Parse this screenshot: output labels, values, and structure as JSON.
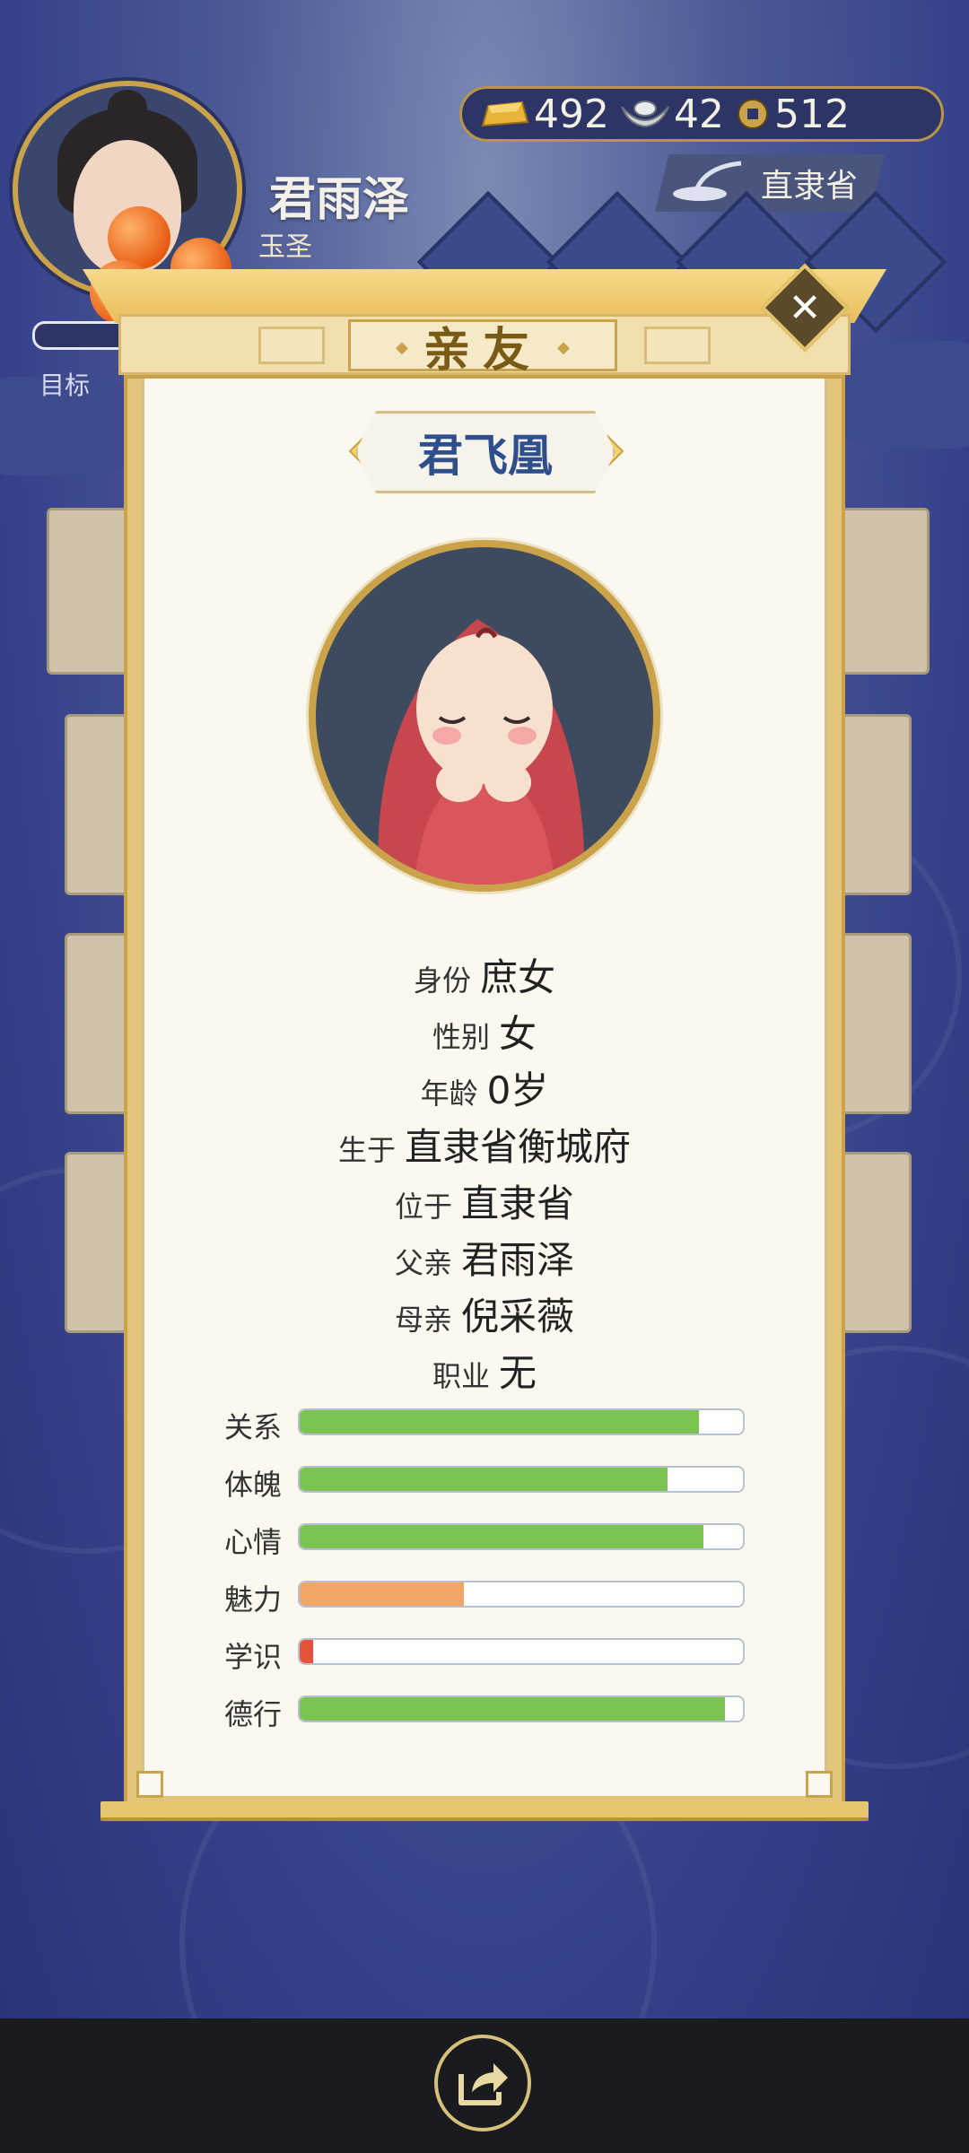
{
  "player": {
    "name": "君雨泽",
    "title": "玉圣",
    "goal_label": "目标"
  },
  "currency": {
    "gold": "492",
    "silver": "42",
    "coins": "512"
  },
  "location": "直隶省",
  "modal": {
    "title": "亲友",
    "character_name": "君飞凰",
    "info": [
      {
        "key": "身份",
        "value": "庶女"
      },
      {
        "key": "性别",
        "value": "女"
      },
      {
        "key": "年龄",
        "value": "0岁"
      },
      {
        "key": "生于",
        "value": "直隶省衡城府"
      },
      {
        "key": "位于",
        "value": "直隶省"
      },
      {
        "key": "父亲",
        "value": "君雨泽"
      },
      {
        "key": "母亲",
        "value": "倪采薇"
      },
      {
        "key": "职业",
        "value": "无"
      }
    ],
    "stats": [
      {
        "label": "关系",
        "level": 0.9,
        "color": "#7cc451"
      },
      {
        "label": "体魄",
        "level": 0.83,
        "color": "#7cc451"
      },
      {
        "label": "心情",
        "level": 0.91,
        "color": "#7cc451"
      },
      {
        "label": "魅力",
        "level": 0.37,
        "color": "#f0a765"
      },
      {
        "label": "学识",
        "level": 0.03,
        "color": "#e5533d"
      },
      {
        "label": "德行",
        "level": 0.96,
        "color": "#7cc451"
      }
    ]
  },
  "icons": {
    "close": "close-icon",
    "share": "share-icon",
    "gold": "gold-ingot-icon",
    "silver": "silver-ingot-icon",
    "coin": "coin-icon"
  }
}
